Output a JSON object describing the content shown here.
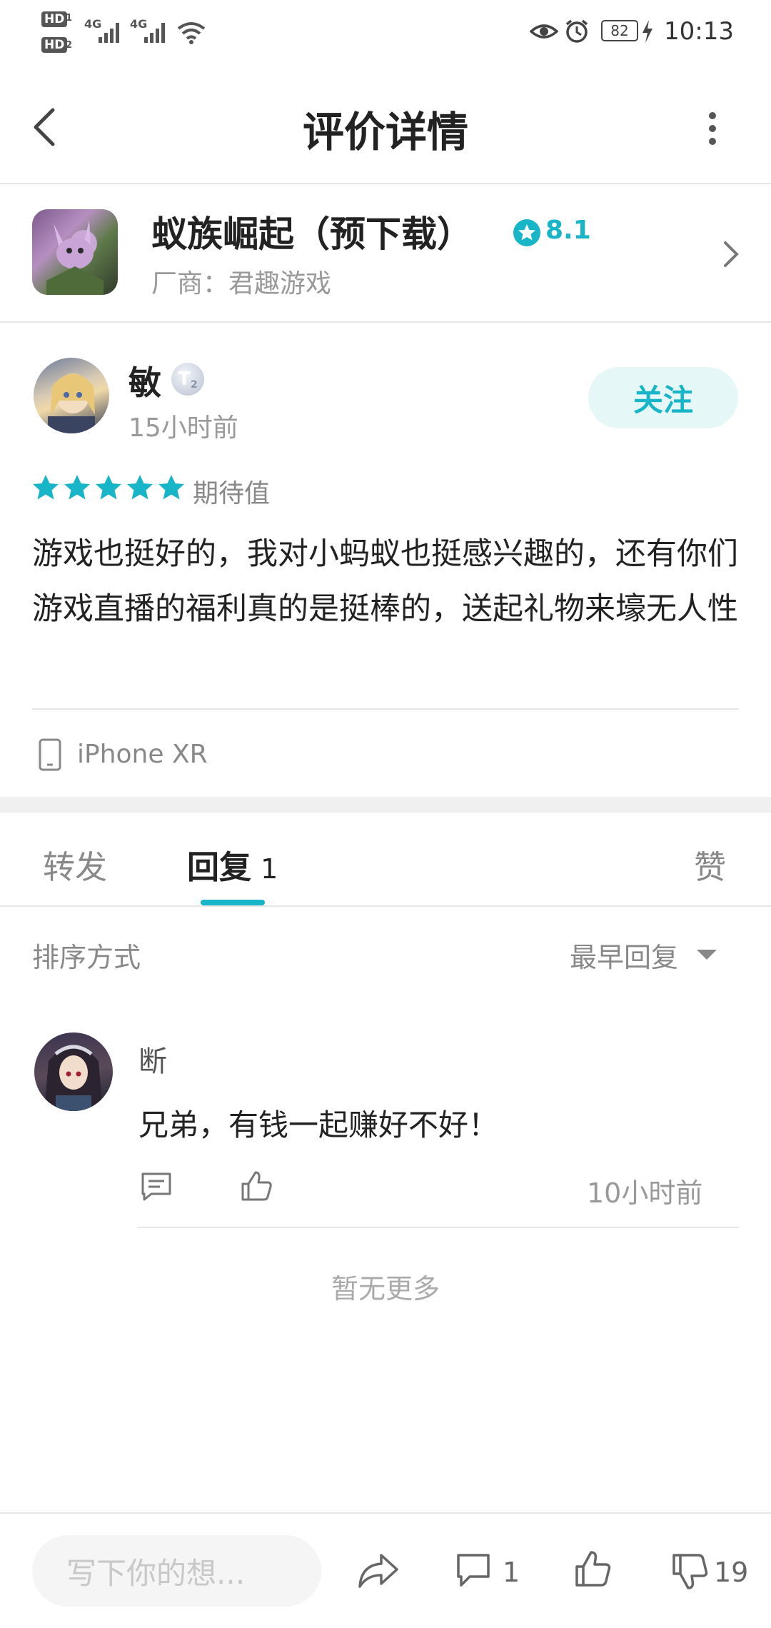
{
  "status_bar": {
    "hd1": "HD",
    "hd1_sub": "1",
    "hd2": "HD",
    "hd2_sub": "2",
    "net1": "4G",
    "net2": "4G",
    "battery": "82",
    "time": "10:13"
  },
  "header": {
    "title": "评价详情"
  },
  "game": {
    "name": "蚁族崛起（预下载）",
    "rating": "8.1",
    "vendor": "厂商：君趣游戏",
    "accent_color": "#17b5c7"
  },
  "review": {
    "user_name": "敏",
    "level_badge": "T",
    "level_sub": "2",
    "time": "15小时前",
    "follow_label": "关注",
    "stars": 5,
    "rating_label": "期待值",
    "text": "游戏也挺好的，我对小蚂蚁也挺感兴趣的，还有你们游戏直播的福利真的是挺棒的，送起礼物来壕无人性",
    "device": "iPhone XR"
  },
  "tabs": {
    "forward": "转发",
    "reply": "回复",
    "reply_count": "1",
    "like": "赞"
  },
  "sort": {
    "label": "排序方式",
    "value": "最早回复"
  },
  "replies": [
    {
      "user": "断",
      "text": "兄弟，有钱一起赚好不好！",
      "time": "10小时前"
    }
  ],
  "no_more": "暂无更多",
  "bottom_bar": {
    "placeholder": "写下你的想...",
    "comment_count": "1",
    "dislike_count": "19"
  }
}
